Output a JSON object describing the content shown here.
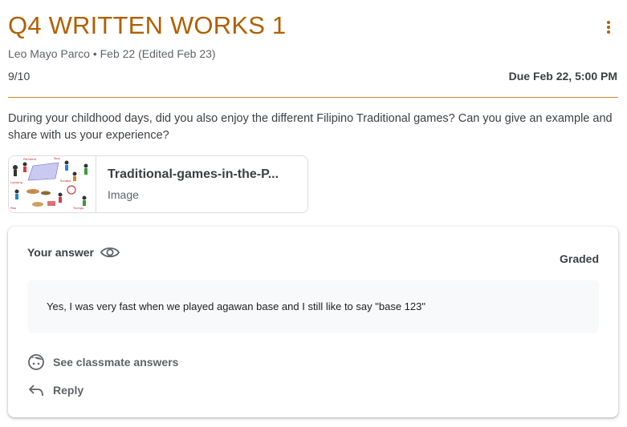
{
  "assignment": {
    "title": "Q4 WRITTEN WORKS 1",
    "meta": "Leo Mayo Parco • Feb 22 (Edited Feb 23)",
    "points": "9/10",
    "due": "Due Feb 22, 5:00 PM",
    "question": "During your childhood days, did you also enjoy the different Filipino Traditional games? Can you give an example and share with us your experience?",
    "more_icon": "more-vert-icon",
    "accent_color": "#b06000"
  },
  "attachment": {
    "name": "Traditional-games-in-the-P...",
    "type": "Image",
    "thumbnail_labels": [
      "Patintero",
      "Sipa",
      "Tumbang Preso",
      "Sungka",
      "Piko",
      "Luksong Tinik",
      "Sack Race",
      "Piko",
      "Bugtong",
      "Trumpo"
    ]
  },
  "answer": {
    "label": "Your answer",
    "visibility_icon": "eye-icon",
    "status": "Graded",
    "text": "Yes, I was very fast when we played agawan base and I still like to say \"base 123\""
  },
  "actions": {
    "classmates_label": "See classmate answers",
    "classmates_icon": "classmate-face-icon",
    "reply_label": "Reply",
    "reply_icon": "reply-icon"
  }
}
